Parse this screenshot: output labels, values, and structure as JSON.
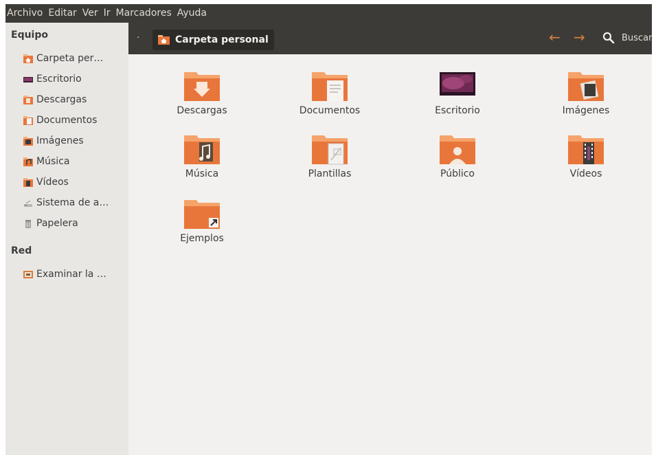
{
  "menubar": {
    "items": [
      "Archivo",
      "Editar",
      "Ver",
      "Ir",
      "Marcadores",
      "Ayuda"
    ]
  },
  "sidebar": {
    "sections": [
      {
        "heading": "Equipo",
        "items": [
          {
            "label": "Carpeta per…",
            "icon": "home-folder-icon"
          },
          {
            "label": "Escritorio",
            "icon": "desktop-icon"
          },
          {
            "label": "Descargas",
            "icon": "downloads-folder-icon"
          },
          {
            "label": "Documentos",
            "icon": "documents-folder-icon"
          },
          {
            "label": "Imágenes",
            "icon": "pictures-folder-icon"
          },
          {
            "label": "Música",
            "icon": "music-folder-icon"
          },
          {
            "label": "Vídeos",
            "icon": "videos-folder-icon"
          },
          {
            "label": "Sistema de a…",
            "icon": "filesystem-icon"
          },
          {
            "label": "Papelera",
            "icon": "trash-icon"
          }
        ]
      },
      {
        "heading": "Red",
        "items": [
          {
            "label": "Examinar la …",
            "icon": "network-icon"
          }
        ]
      }
    ]
  },
  "toolbar": {
    "breadcrumb": "Carpeta personal",
    "search_label": "Buscar",
    "back_icon": "back-arrow-icon",
    "forward_icon": "forward-arrow-icon"
  },
  "files": [
    {
      "name": "Descargas",
      "icon": "downloads-folder-icon"
    },
    {
      "name": "Documentos",
      "icon": "documents-folder-icon"
    },
    {
      "name": "Escritorio",
      "icon": "desktop-icon"
    },
    {
      "name": "Imágenes",
      "icon": "pictures-folder-icon"
    },
    {
      "name": "Música",
      "icon": "music-folder-icon"
    },
    {
      "name": "Plantillas",
      "icon": "templates-folder-icon"
    },
    {
      "name": "Público",
      "icon": "public-folder-icon"
    },
    {
      "name": "Vídeos",
      "icon": "videos-folder-icon"
    },
    {
      "name": "Ejemplos",
      "icon": "examples-folder-icon"
    }
  ],
  "colors": {
    "folder_orange": "#e8763b",
    "folder_tab": "#f3b078",
    "toolbar_dark": "#3c3b37",
    "accent_arrow": "#d4813f"
  }
}
